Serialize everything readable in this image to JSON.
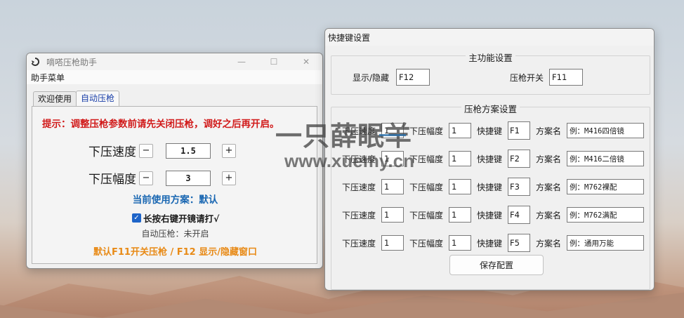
{
  "win1": {
    "title": "嘀嗒压枪助手",
    "menu": "助手菜单",
    "tabs": [
      {
        "label": "欢迎使用"
      },
      {
        "label": "自动压枪"
      }
    ],
    "hint": "提示：调整压枪参数前请先关闭压枪，调好之后再开启。",
    "speed": {
      "label": "下压速度",
      "value": "1.5",
      "minus": "−",
      "plus": "+"
    },
    "range": {
      "label": "下压幅度",
      "value": "3",
      "minus": "−",
      "plus": "+"
    },
    "scheme_text": "当前使用方案：默认",
    "checkbox": {
      "label": "长按右键开镜请打√",
      "checked": true
    },
    "auto_status": "自动压枪：未开启",
    "footer": "默认F11开关压枪 / F12 显示/隐藏窗口"
  },
  "win2": {
    "title": "快捷键设置",
    "main_group": {
      "title": "主功能设置",
      "show_hide_label": "显示/隐藏",
      "show_hide_key": "F12",
      "toggle_label": "压枪开关",
      "toggle_key": "F11"
    },
    "scheme_group": {
      "title": "压枪方案设置",
      "speed_label": "下压速度",
      "range_label": "下压幅度",
      "hotkey_label": "快捷键",
      "name_label": "方案名",
      "rows": [
        {
          "speed": "1",
          "range": "1",
          "key": "F1",
          "name": "例：M416四倍镜"
        },
        {
          "speed": "1",
          "range": "1",
          "key": "F2",
          "name": "例：M416二倍镜"
        },
        {
          "speed": "1",
          "range": "1",
          "key": "F3",
          "name": "例：M762裸配"
        },
        {
          "speed": "1",
          "range": "1",
          "key": "F4",
          "name": "例：M762满配"
        },
        {
          "speed": "1",
          "range": "1",
          "key": "F5",
          "name": "例：通用万能"
        }
      ],
      "save_label": "保存配置"
    }
  },
  "watermark": {
    "line1": "一只薛眠羊",
    "line2": "www.xuemy.cn"
  }
}
